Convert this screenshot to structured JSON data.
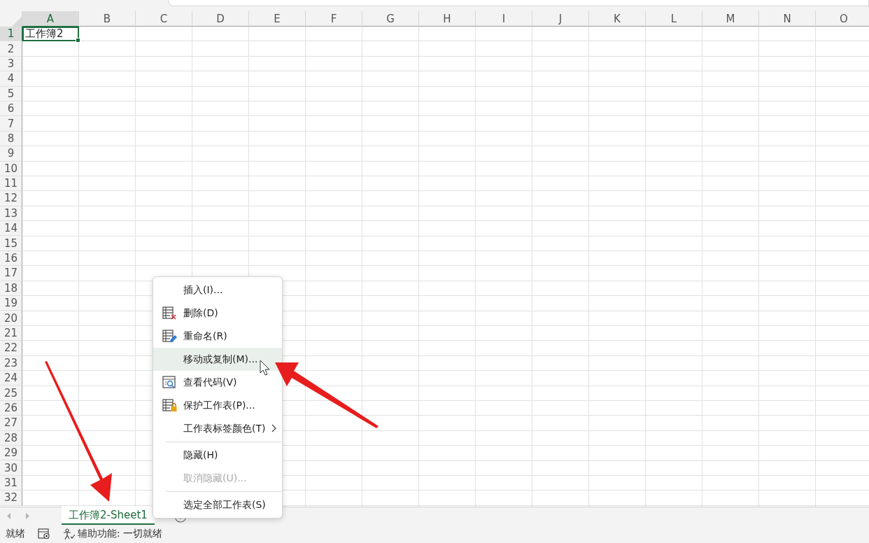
{
  "columns": [
    {
      "label": "A",
      "selected": true
    },
    {
      "label": "B",
      "selected": false
    },
    {
      "label": "C",
      "selected": false
    },
    {
      "label": "D",
      "selected": false
    },
    {
      "label": "E",
      "selected": false
    },
    {
      "label": "F",
      "selected": false
    },
    {
      "label": "G",
      "selected": false
    },
    {
      "label": "H",
      "selected": false
    },
    {
      "label": "I",
      "selected": false
    },
    {
      "label": "J",
      "selected": false
    },
    {
      "label": "K",
      "selected": false
    },
    {
      "label": "L",
      "selected": false
    },
    {
      "label": "M",
      "selected": false
    },
    {
      "label": "N",
      "selected": false
    },
    {
      "label": "O",
      "selected": false
    }
  ],
  "rows": [
    {
      "label": "1",
      "selected": true,
      "cells": [
        {
          "text": "工作簿2",
          "selected": true
        }
      ]
    },
    {
      "label": "2",
      "selected": false
    },
    {
      "label": "3",
      "selected": false
    },
    {
      "label": "4",
      "selected": false
    },
    {
      "label": "5",
      "selected": false
    },
    {
      "label": "6",
      "selected": false
    },
    {
      "label": "7",
      "selected": false
    },
    {
      "label": "8",
      "selected": false
    },
    {
      "label": "9",
      "selected": false
    },
    {
      "label": "10",
      "selected": false
    },
    {
      "label": "11",
      "selected": false
    },
    {
      "label": "12",
      "selected": false
    },
    {
      "label": "13",
      "selected": false
    },
    {
      "label": "14",
      "selected": false
    },
    {
      "label": "15",
      "selected": false
    },
    {
      "label": "16",
      "selected": false
    },
    {
      "label": "17",
      "selected": false
    },
    {
      "label": "18",
      "selected": false
    },
    {
      "label": "19",
      "selected": false
    },
    {
      "label": "20",
      "selected": false
    },
    {
      "label": "21",
      "selected": false
    },
    {
      "label": "22",
      "selected": false
    },
    {
      "label": "23",
      "selected": false
    },
    {
      "label": "24",
      "selected": false
    },
    {
      "label": "25",
      "selected": false
    },
    {
      "label": "26",
      "selected": false
    },
    {
      "label": "27",
      "selected": false
    },
    {
      "label": "28",
      "selected": false
    },
    {
      "label": "29",
      "selected": false
    },
    {
      "label": "30",
      "selected": false
    },
    {
      "label": "31",
      "selected": false
    },
    {
      "label": "32",
      "selected": false
    }
  ],
  "sheet_tabs": [
    {
      "label": "工作簿2-Sheet1",
      "selected": true
    }
  ],
  "context_menu": [
    {
      "kind": "item",
      "label": "插入(I)...",
      "highlighted": false,
      "disabled": false
    },
    {
      "kind": "delete",
      "label": "删除(D)",
      "highlighted": false,
      "disabled": false
    },
    {
      "kind": "rename",
      "label": "重命名(R)",
      "highlighted": false,
      "disabled": false
    },
    {
      "kind": "item",
      "label": "移动或复制(M)...",
      "highlighted": true,
      "disabled": false
    },
    {
      "kind": "code",
      "label": "查看代码(V)",
      "highlighted": false,
      "disabled": false
    },
    {
      "kind": "protect",
      "label": "保护工作表(P)...",
      "highlighted": false,
      "disabled": false
    },
    {
      "kind": "submenu",
      "label": "工作表标签颜色(T)",
      "highlighted": false,
      "disabled": false
    },
    {
      "kind": "separator"
    },
    {
      "kind": "item",
      "label": "隐藏(H)",
      "highlighted": false,
      "disabled": false
    },
    {
      "kind": "item",
      "label": "取消隐藏(U)...",
      "highlighted": false,
      "disabled": true
    },
    {
      "kind": "separator"
    },
    {
      "kind": "item",
      "label": "选定全部工作表(S)",
      "highlighted": false,
      "disabled": false
    }
  ],
  "status_bar": {
    "ready": "就绪",
    "accessibility": "辅助功能: 一切就绪"
  }
}
